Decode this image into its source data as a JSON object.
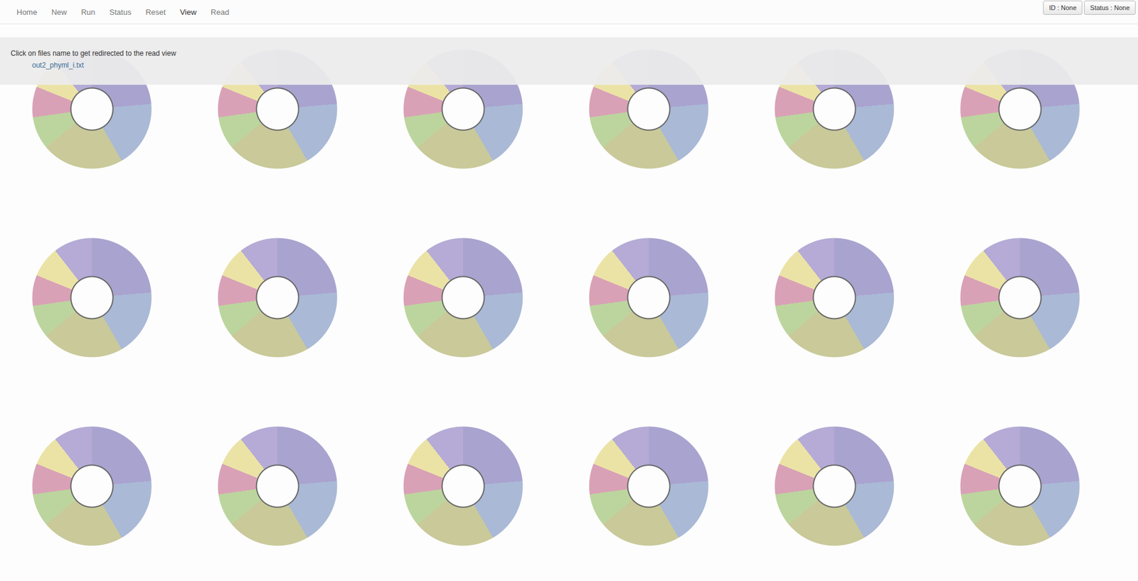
{
  "nav": [
    {
      "label": "Home",
      "selected": false
    },
    {
      "label": "New",
      "selected": false
    },
    {
      "label": "Run",
      "selected": false
    },
    {
      "label": "Status",
      "selected": false
    },
    {
      "label": "Reset",
      "selected": false
    },
    {
      "label": "View",
      "selected": true
    },
    {
      "label": "Read",
      "selected": false
    }
  ],
  "status_buttons": [
    "ID : None",
    "Status : None"
  ],
  "panel": {
    "message": "Click on files name to get redirected to the read view",
    "files": [
      "out2_phyml_i.txt"
    ]
  }
}
